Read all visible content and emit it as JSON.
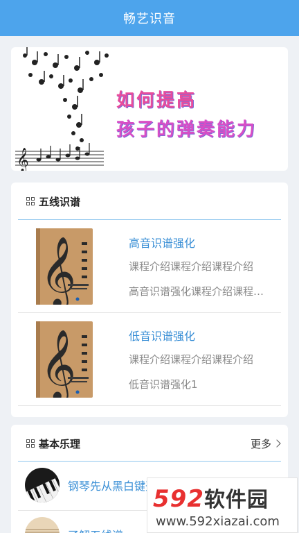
{
  "header": {
    "title": "畅艺识音"
  },
  "banner": {
    "line1": "如何提高",
    "line2": "孩子的弹奏能力"
  },
  "section_staff": {
    "title": "五线识谱",
    "courses": [
      {
        "title": "高音识谱强化",
        "desc": "课程介绍课程介绍课程介绍",
        "sub": "高音识谱强化课程介绍课程介绍"
      },
      {
        "title": "低音识谱强化",
        "desc": "课程介绍课程介绍课程介绍",
        "sub": "低音识谱强化1"
      }
    ]
  },
  "section_theory": {
    "title": "基本乐理",
    "more": "更多",
    "items": [
      {
        "label": "钢琴先从黑白键开始"
      },
      {
        "label": "了解五线谱"
      }
    ]
  },
  "watermark": {
    "logo_num": "592",
    "logo_cn": "软件园",
    "url": "www.592xiazai.com"
  },
  "colors": {
    "accent": "#4da4ec",
    "link": "#3a8fd6"
  }
}
